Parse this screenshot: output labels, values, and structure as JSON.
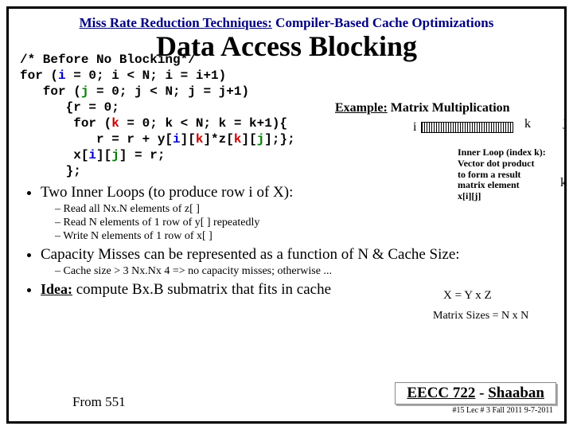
{
  "header": {
    "underlined": "Miss Rate Reduction Techniques:",
    "rest": " Compiler-Based Cache Optimizations"
  },
  "title": "Data Access Blocking",
  "code": {
    "l1a": "/* Before No Blocking*/",
    "l2a": "for (",
    "l2b": "i",
    "l2c": " = 0; i < N; i = i+1)",
    "l3a": "   for (",
    "l3b": "j",
    "l3c": " = 0; j < N; j = j+1)",
    "l4": "      {r = 0;",
    "l5a": "       for (",
    "l5b": "k",
    "l5c": " = 0; k < N; k = k+1){",
    "l6a": "          r = r + y[",
    "l6b": "i",
    "l6c": "][",
    "l6d": "k",
    "l6e": "]*z[",
    "l6f": "k",
    "l6g": "][",
    "l6h": "j",
    "l6i": "];};",
    "l7a": "       x[",
    "l7b": "i",
    "l7c": "][",
    "l7d": "j",
    "l7e": "] = r;",
    "l8": "      };"
  },
  "example": {
    "label": "Example:",
    "text": "  Matrix Multiplication"
  },
  "diagram": {
    "i": "i",
    "k": "k",
    "j": "j",
    "kright": "k",
    "note1": "Inner Loop (index k):",
    "note2": "Vector dot product",
    "note3": "to form a result",
    "note4": "matrix element",
    "note5": "x[i][j]"
  },
  "bullets": {
    "b1": "Two Inner Loops (to produce row i of X):",
    "b1s1": "Read all Nx.N elements of z[ ]",
    "b1s2": "Read N elements of 1 row of y[ ] repeatedly",
    "b1s3": "Write N elements of 1 row of x[ ]",
    "b2": "Capacity Misses can be represented as a function of N & Cache Size:",
    "b2s1": "Cache size > 3 Nx.Nx 4  =>  no capacity misses; otherwise ...",
    "b3_u": "Idea:",
    "b3_r": " compute  Bx.B submatrix that fits in cache"
  },
  "eq": "X  =  Y x  Z",
  "msize": "Matrix Sizes = N x N",
  "from": "From 551",
  "footer": {
    "course": "EECC 722",
    "dash": " - ",
    "name": "Shaaban",
    "sub": "#15   Lec # 3   Fall 2011  9-7-2011"
  }
}
